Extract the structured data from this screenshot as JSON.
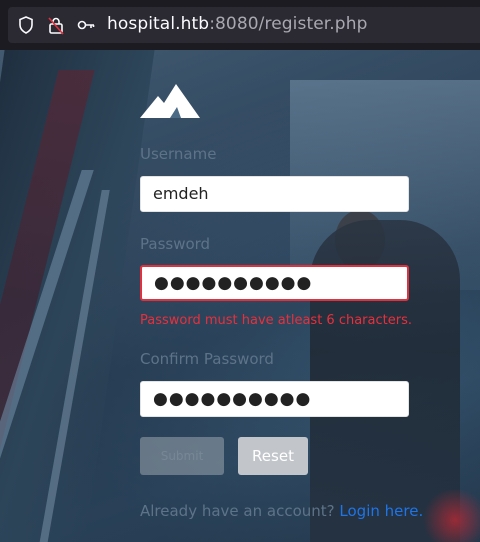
{
  "browser": {
    "url_host": "hospital.htb",
    "url_rest": ":8080/register.php",
    "icons": [
      "shield-icon",
      "lock-icon",
      "key-icon"
    ]
  },
  "form": {
    "username": {
      "label": "Username",
      "value": "emdeh"
    },
    "password": {
      "label": "Password",
      "masked_value": "●●●●●●●●●●",
      "error": "Password must have atleast 6 characters."
    },
    "confirm_password": {
      "label": "Confirm Password",
      "masked_value": "●●●●●●●●●●"
    },
    "submit_label": "Submit",
    "reset_label": "Reset",
    "footer_text": "Already have an account?",
    "login_link": "Login here."
  },
  "colors": {
    "error": "#e8303c",
    "link": "#1f74e6"
  }
}
